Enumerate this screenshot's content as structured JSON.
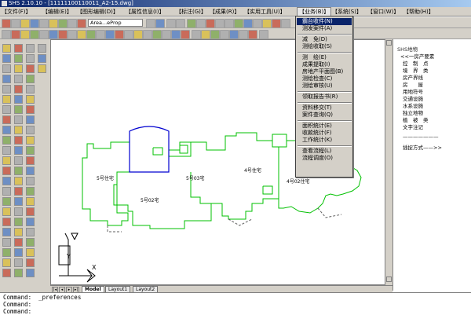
{
  "titlebar": {
    "title": "SHS 2.10.10 - [11111100110011_A2-15.dwg]"
  },
  "menubar": {
    "items": [
      "【文件(F)】",
      "【编辑(E)】",
      "【图形编辑(D)】",
      "【属性信息(I)】",
      "【标注(G)】",
      "【成果(R)】",
      "【实用工具(U)】",
      "【业务(B)】",
      "【系统(S)】",
      "【窗口(W)】",
      "【帮助(H)】"
    ],
    "active_index": 7
  },
  "toolbar": {
    "layer_dropdown": "Area...eProp"
  },
  "drawing": {
    "labels": [
      "5号住宅",
      "5号03宅",
      "5号02宅",
      "4号住宅",
      "4号02住宅"
    ],
    "ucs_x": "X",
    "ucs_y": "Y"
  },
  "dropdown": {
    "items": [
      "霸台收件(N)",
      "测发案件(A)",
      "减　免(D)",
      "测绘收取(S)",
      "测　绘(E)",
      "成果提取(I)",
      "房地产平面图(B)",
      "测绘检查(C)",
      "测绘审核(U)",
      "领取报告书(R)",
      "资料移交(T)",
      "案件查询(Q)",
      "面积统计(E)",
      "收款统计(F)",
      "工作统计(K)",
      "查看流程(L)",
      "流程调度(O)"
    ],
    "highlight_index": 0
  },
  "right_panel": {
    "items": [
      "SHS地物",
      "<<一房产要素",
      "控　制　点",
      "境　界　类",
      "房产界线",
      "房　　屋",
      "用地符号",
      "交通设施",
      "水系设施",
      "独立地物",
      "植　被　类",
      "文字注记",
      "———————",
      "插捉方式——>>"
    ]
  },
  "tabs": [
    "Model",
    "Layout1",
    "Layout2"
  ],
  "active_tab": 0,
  "command": {
    "line1": "Command:  _preferences",
    "line2": "Command:",
    "line3": "Command:"
  }
}
